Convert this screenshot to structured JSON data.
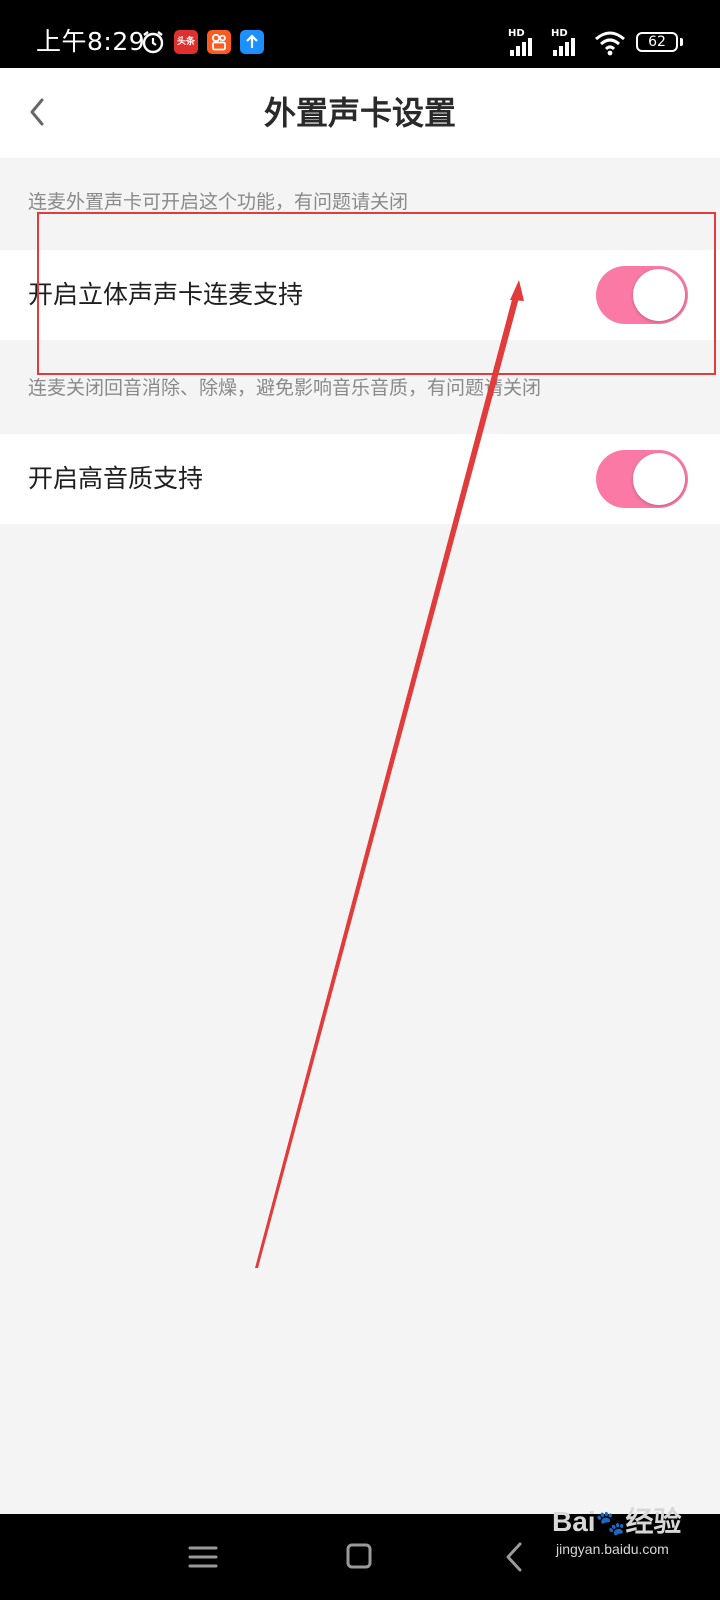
{
  "status_bar": {
    "time": "上午8:29",
    "app_badge_toutiao": "头条",
    "hd_label": "HD",
    "battery_level": "62"
  },
  "header": {
    "title": "外置声卡设置"
  },
  "settings": [
    {
      "description": "连麦外置声卡可开启这个功能，有问题请关闭",
      "label": "开启立体声声卡连麦支持",
      "enabled": true
    },
    {
      "description": "连麦关闭回音消除、除燥，避免影响音乐音质，有问题请关闭",
      "label": "开启高音质支持",
      "enabled": true
    }
  ],
  "colors": {
    "toggle_on": "#fb7aa5",
    "annotation": "#e23b3b"
  },
  "watermark": {
    "brand": "Bai",
    "brand_suffix": "经验",
    "site": "jingyan.baidu.com"
  }
}
